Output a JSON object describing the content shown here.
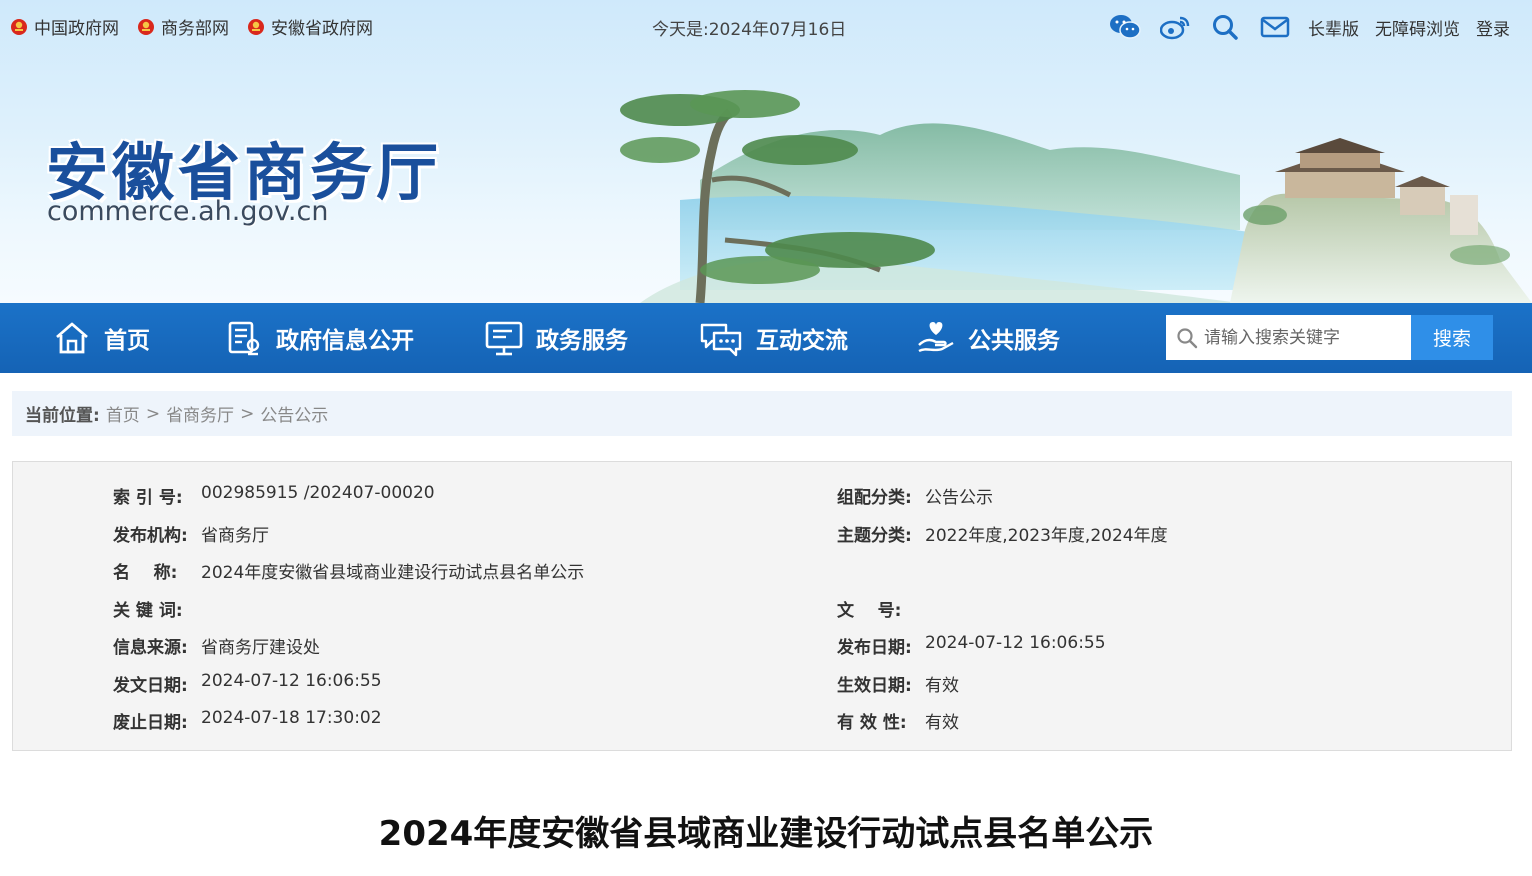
{
  "topbar": {
    "links": [
      "中国政府网",
      "商务部网",
      "安徽省政府网"
    ],
    "today_label": "今天是:",
    "today_date": "2024年07月16日",
    "right_links": [
      "长辈版",
      "无障碍浏览",
      "登录"
    ],
    "icons": [
      "wechat-icon",
      "weibo-icon",
      "search-icon",
      "mail-icon"
    ]
  },
  "logo": {
    "name": "安徽省商务厅",
    "url": "commerce.ah.gov.cn"
  },
  "nav": {
    "items": [
      {
        "label": "首页",
        "icon": "home-icon"
      },
      {
        "label": "政府信息公开",
        "icon": "document-icon"
      },
      {
        "label": "政务服务",
        "icon": "monitor-icon"
      },
      {
        "label": "互动交流",
        "icon": "chat-icon"
      },
      {
        "label": "公共服务",
        "icon": "hand-heart-icon"
      }
    ],
    "search_placeholder": "请输入搜索关键字",
    "search_button": "搜索"
  },
  "breadcrumb": {
    "label": "当前位置:",
    "items": [
      "首页",
      "省商务厅",
      "公告公示"
    ],
    "separator": ">"
  },
  "info": {
    "left": [
      {
        "label": "索 引 号:",
        "value": "002985915 /202407-00020"
      },
      {
        "label": "发布机构:",
        "value": "省商务厅"
      },
      {
        "label": "名    称:",
        "value": "2024年度安徽省县域商业建设行动试点县名单公示"
      },
      {
        "label": "关 键 词:",
        "value": ""
      },
      {
        "label": "信息来源:",
        "value": "省商务厅建设处"
      },
      {
        "label": "发文日期:",
        "value": "2024-07-12 16:06:55"
      },
      {
        "label": "废止日期:",
        "value": "2024-07-18 17:30:02"
      }
    ],
    "right": [
      {
        "label": "组配分类:",
        "value": "公告公示"
      },
      {
        "label": "主题分类:",
        "value": "2022年度,2023年度,2024年度"
      },
      {
        "label": "",
        "value": ""
      },
      {
        "label": "文    号:",
        "value": ""
      },
      {
        "label": "发布日期:",
        "value": "2024-07-12 16:06:55"
      },
      {
        "label": "生效日期:",
        "value": "有效"
      },
      {
        "label": "有 效 性:",
        "value": "有效"
      }
    ]
  },
  "article": {
    "title": "2024年度安徽省县域商业建设行动试点县名单公示"
  },
  "colors": {
    "nav_blue": "#1a6cc2",
    "search_button": "#2f8fe8",
    "logo_blue": "#1a4f9c"
  }
}
